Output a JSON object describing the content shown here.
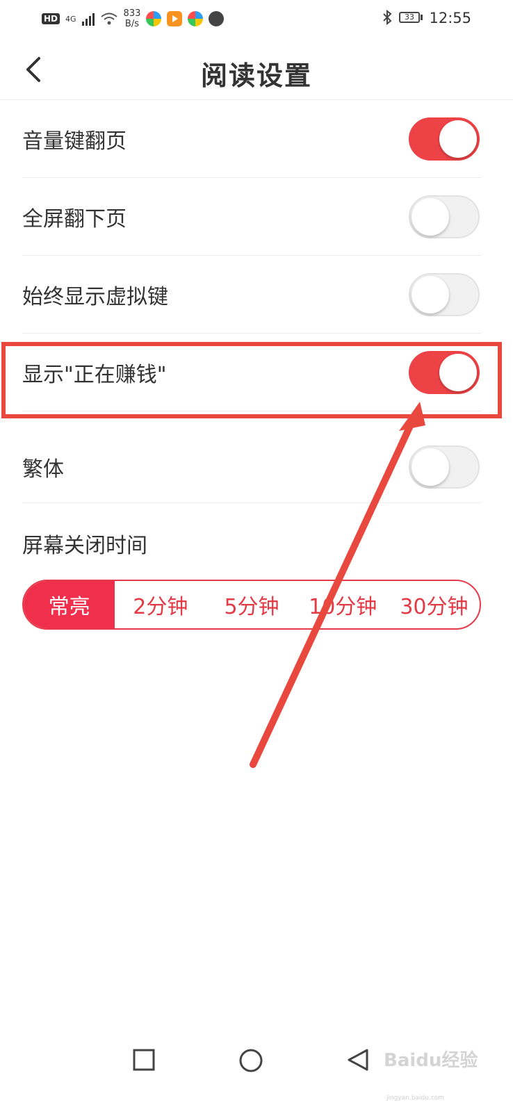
{
  "status_bar": {
    "hd": "HD",
    "network": "4G",
    "speed_value": "833",
    "speed_unit": "B/s",
    "battery": "33",
    "time": "12:55"
  },
  "header": {
    "title": "阅读设置"
  },
  "settings": [
    {
      "label": "音量键翻页",
      "enabled": true
    },
    {
      "label": "全屏翻下页",
      "enabled": false
    },
    {
      "label": "始终显示虚拟键",
      "enabled": false
    },
    {
      "label": "显示\"正在赚钱\"",
      "enabled": true
    },
    {
      "label": "繁体",
      "enabled": false
    }
  ],
  "screen_timeout": {
    "label": "屏幕关闭时间",
    "options": [
      "常亮",
      "2分钟",
      "5分钟",
      "10分钟",
      "30分钟"
    ],
    "selected": "常亮"
  },
  "watermark": {
    "brand": "Baidu经验",
    "url": "jingyan.baidu.com"
  },
  "colors": {
    "accent": "#ee4346",
    "annotation": "#e9483e"
  }
}
